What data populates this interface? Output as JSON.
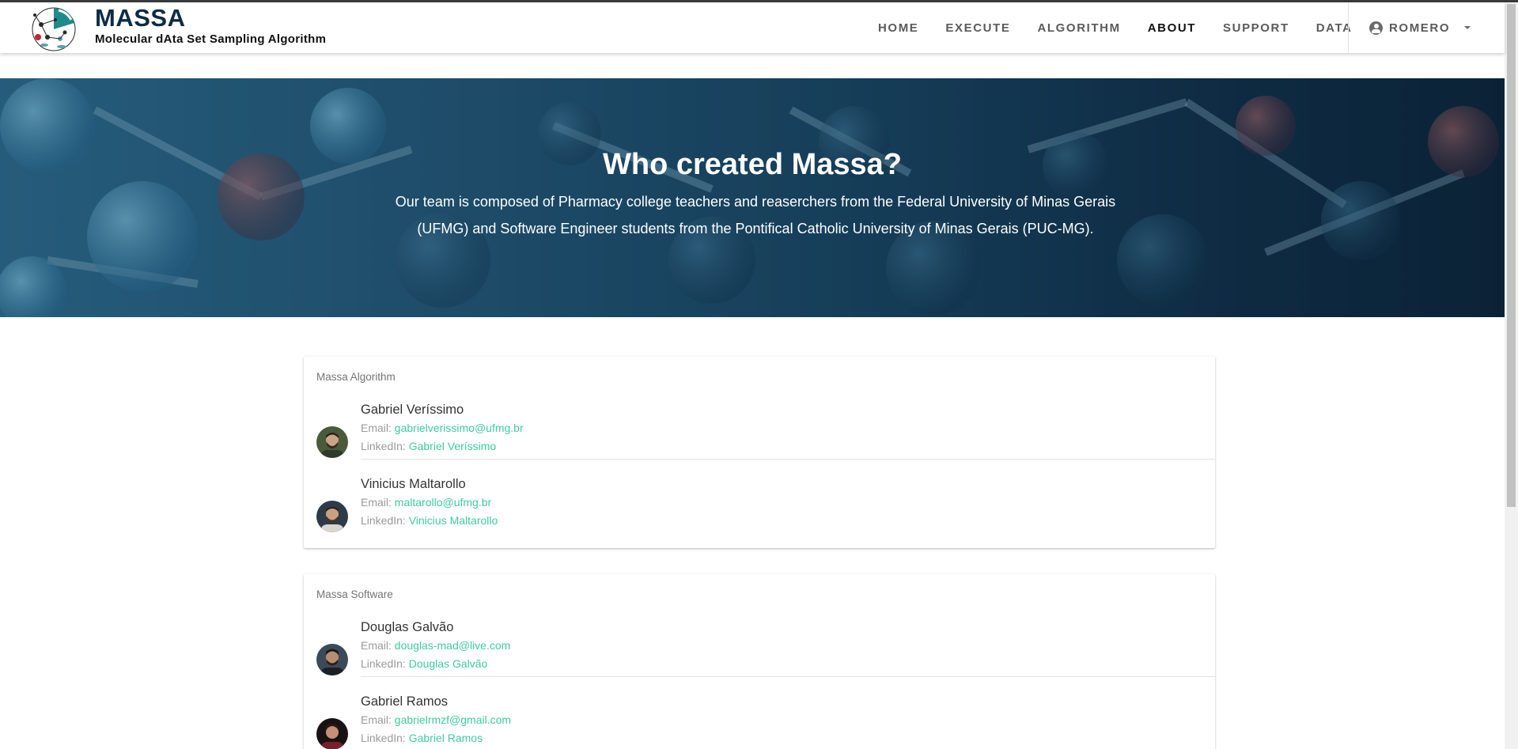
{
  "brand": {
    "title": "MASSA",
    "subtitle": "Molecular dAta Set Sampling Algorithm"
  },
  "nav": {
    "items": [
      {
        "label": "HOME",
        "active": false
      },
      {
        "label": "EXECUTE",
        "active": false
      },
      {
        "label": "ALGORITHM",
        "active": false
      },
      {
        "label": "ABOUT",
        "active": true
      },
      {
        "label": "SUPPORT",
        "active": false
      },
      {
        "label": "DATA",
        "active": false
      }
    ],
    "user": "ROMERO",
    "user_icon": "account-circle-icon"
  },
  "hero": {
    "title": "Who created Massa?",
    "text_line1": "Our team is composed of Pharmacy college teachers and reaserchers from the Federal University of Minas Gerais",
    "text_line2": "(UFMG) and Software Engineer students from the Pontifical Catholic University of Minas Gerais (PUC-MG)."
  },
  "sections": [
    {
      "title": "Massa Algorithm",
      "members": [
        {
          "name": "Gabriel Veríssimo",
          "email_label": "Email:",
          "email": "gabrielverissimo@ufmg.br",
          "linkedin_label": "LinkedIn:",
          "linkedin": "Gabriel Veríssimo"
        },
        {
          "name": "Vinicius Maltarollo",
          "email_label": "Email:",
          "email": "maltarollo@ufmg.br",
          "linkedin_label": "LinkedIn:",
          "linkedin": "Vinicius Maltarollo"
        }
      ]
    },
    {
      "title": "Massa Software",
      "members": [
        {
          "name": "Douglas Galvão",
          "email_label": "Email:",
          "email": "douglas-mad@live.com",
          "linkedin_label": "LinkedIn:",
          "linkedin": "Douglas Galvão"
        },
        {
          "name": "Gabriel Ramos",
          "email_label": "Email:",
          "email": "gabrielrmzf@gmail.com",
          "linkedin_label": "LinkedIn:",
          "linkedin": "Gabriel Ramos"
        }
      ]
    }
  ],
  "colors": {
    "brand": "#0d2b45",
    "link": "#3fcca0",
    "hero_dark": "#0b2236"
  }
}
